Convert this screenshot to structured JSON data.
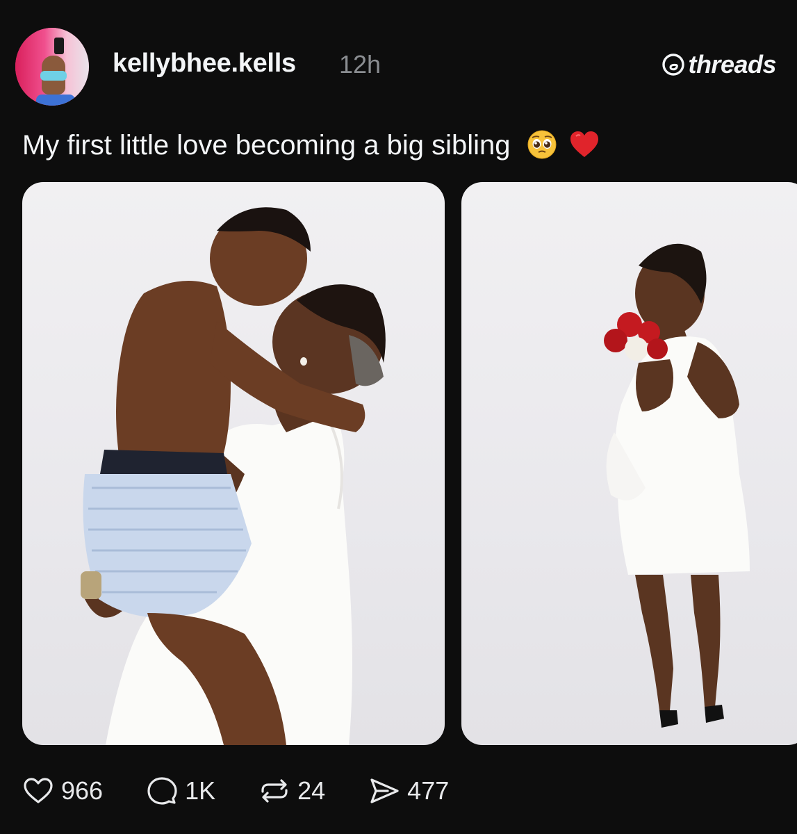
{
  "author": {
    "username": "kellybhee.kells",
    "time_ago": "12h"
  },
  "brand": {
    "name": "threads",
    "icon": "threads-logo-icon"
  },
  "post": {
    "caption": "My first little love becoming a big sibling",
    "caption_emojis": [
      "pleading-face-emoji",
      "red-heart-emoji"
    ],
    "images": [
      {
        "icon": "photo-mother-kissing-son"
      },
      {
        "icon": "photo-pregnant-woman-with-roses"
      }
    ]
  },
  "stats": {
    "likes": "966",
    "replies": "1K",
    "reposts": "24",
    "shares": "477"
  },
  "colors": {
    "background": "#0d0d0d",
    "text": "#f3f5f7",
    "muted": "#8a8d91"
  }
}
